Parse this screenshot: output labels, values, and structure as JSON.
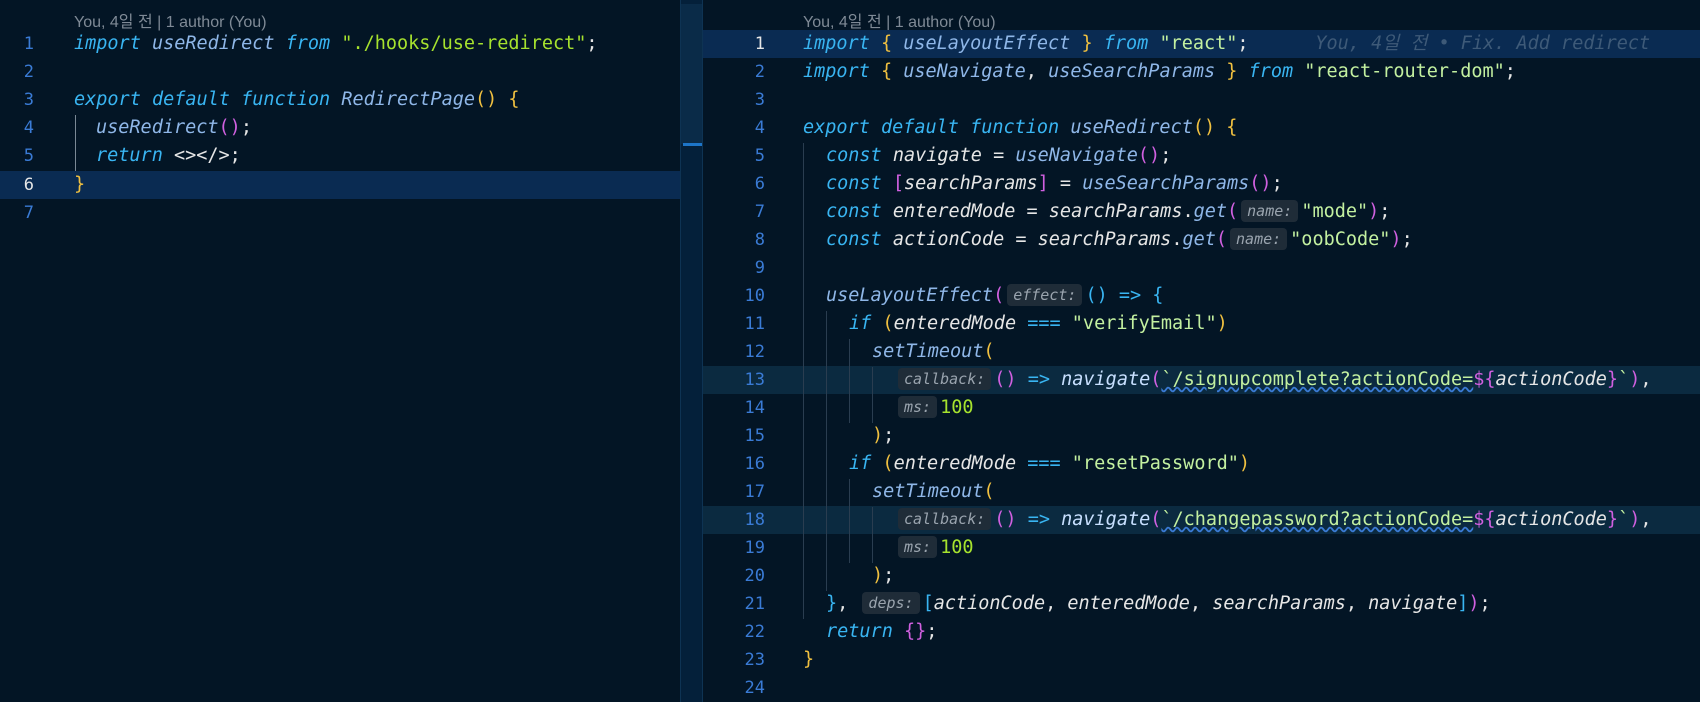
{
  "left_editor": {
    "blame": "You, 4일 전 | 1 author (You)",
    "lines": [
      {
        "n": "1"
      },
      {
        "n": "2"
      },
      {
        "n": "3"
      },
      {
        "n": "4"
      },
      {
        "n": "5"
      },
      {
        "n": "6"
      },
      {
        "n": "7"
      }
    ]
  },
  "right_editor": {
    "blame": "You, 4일 전 | 1 author (You)",
    "inline_blame": "You, 4일 전 • Fix. Add redirect",
    "lines": [
      {
        "n": "1"
      },
      {
        "n": "2"
      },
      {
        "n": "3"
      },
      {
        "n": "4"
      },
      {
        "n": "5"
      },
      {
        "n": "6"
      },
      {
        "n": "7"
      },
      {
        "n": "8"
      },
      {
        "n": "9"
      },
      {
        "n": "10"
      },
      {
        "n": "11"
      },
      {
        "n": "12"
      },
      {
        "n": "13"
      },
      {
        "n": "14"
      },
      {
        "n": "15"
      },
      {
        "n": "16"
      },
      {
        "n": "17"
      },
      {
        "n": "18"
      },
      {
        "n": "19"
      },
      {
        "n": "20"
      },
      {
        "n": "21"
      },
      {
        "n": "22"
      },
      {
        "n": "23"
      },
      {
        "n": "24"
      }
    ]
  },
  "tokens": {
    "import": "import",
    "from": "from",
    "export": "export",
    "default": "default",
    "function": "function",
    "const": "const",
    "if": "if",
    "return": "return",
    "useRedirect": "useRedirect",
    "RedirectPage": "RedirectPage",
    "useLayoutEffect": "useLayoutEffect",
    "useNavigate": "useNavigate",
    "useSearchParams": "useSearchParams",
    "navigate": "navigate",
    "searchParams": "searchParams",
    "enteredMode": "enteredMode",
    "actionCode": "actionCode",
    "get": "get",
    "setTimeout": "setTimeout",
    "str_hooks": "\"./hooks/use-redirect\"",
    "str_react": "\"react\"",
    "str_router": "\"react-router-dom\"",
    "str_mode": "\"mode\"",
    "str_oob": "\"oobCode\"",
    "str_verify": "\"verifyEmail\"",
    "str_reset": "\"resetPassword\"",
    "tpl_signup": "`/signupcomplete?actionCode=",
    "tpl_change": "`/changepassword?actionCode=",
    "fragment": "<></>",
    "num_100": "100"
  },
  "hints": {
    "name": "name:",
    "effect": "effect:",
    "callback": "callback:",
    "ms": "ms:",
    "deps": "deps:"
  }
}
